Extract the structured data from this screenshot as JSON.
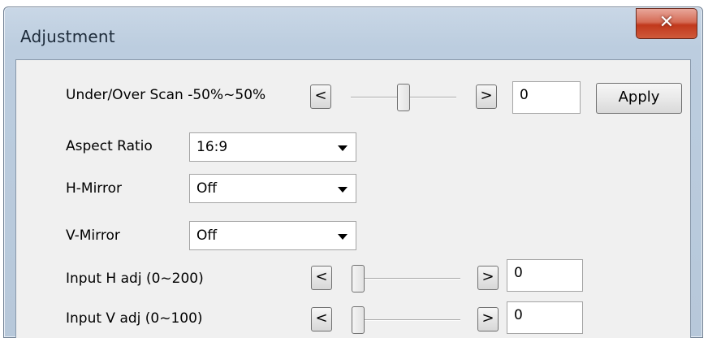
{
  "window": {
    "title": "Adjustment",
    "close_label": "✕"
  },
  "scan": {
    "label": "Under/Over Scan -50%~50%",
    "dec_label": "<",
    "inc_label": ">",
    "value": "0",
    "slider_fraction": 0.5,
    "apply_label": "Apply"
  },
  "aspect": {
    "label": "Aspect Ratio",
    "selected": "16:9"
  },
  "hmirror": {
    "label": "H-Mirror",
    "selected": "Off"
  },
  "vmirror": {
    "label": "V-Mirror",
    "selected": "Off"
  },
  "input_h": {
    "label": "Input H adj (0~200)",
    "dec_label": "<",
    "inc_label": ">",
    "value": "0",
    "slider_fraction": 0.0
  },
  "input_v": {
    "label": "Input V adj (0~100)",
    "dec_label": "<",
    "inc_label": ">",
    "value": "0",
    "slider_fraction": 0.0
  }
}
